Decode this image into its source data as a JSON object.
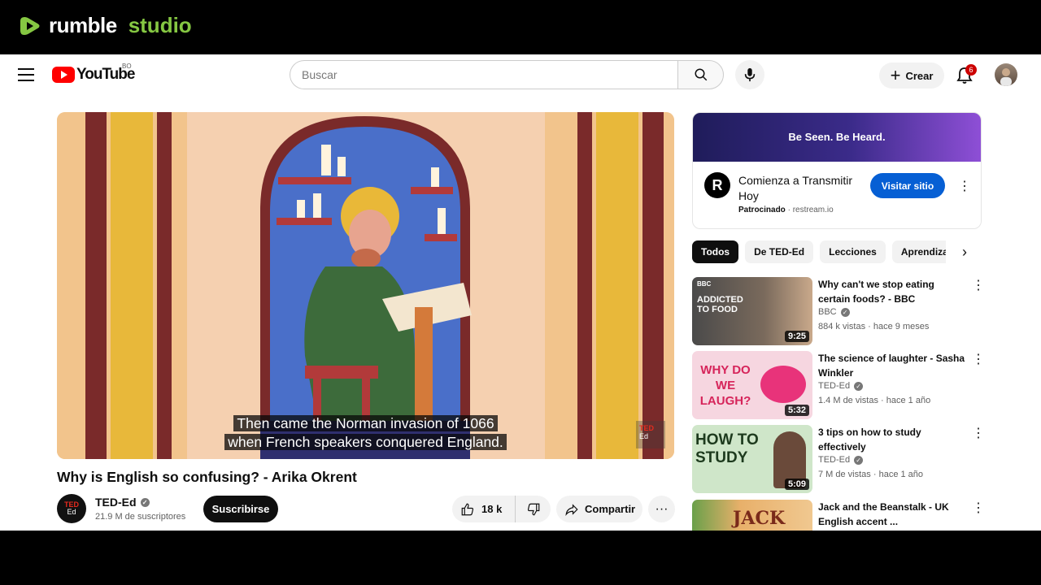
{
  "rumble": {
    "brand": "rumble",
    "product": "studio"
  },
  "masthead": {
    "country_code": "BO",
    "search_placeholder": "Buscar",
    "create_label": "Crear",
    "notifications_count": "6"
  },
  "player": {
    "caption_line1": "Then came the Norman invasion of 1066",
    "caption_line2": "when French speakers conquered England.",
    "watermark": "Ed"
  },
  "video": {
    "title": "Why is English so confusing? - Arika Okrent",
    "channel": "TED-Ed",
    "subscribers": "21.9 M de suscriptores",
    "subscribe_label": "Suscribirse",
    "likes": "18 k",
    "share_label": "Compartir"
  },
  "ad": {
    "banner_text": "Be Seen. Be Heard.",
    "logo_letter": "R",
    "title": "Comienza a Transmitir Hoy",
    "sponsored": "Patrocinado",
    "domain": "restream.io",
    "cta": "Visitar sitio"
  },
  "chips": [
    "Todos",
    "De TED-Ed",
    "Lecciones",
    "Aprendizaje"
  ],
  "recommendations": [
    {
      "title": "Why can't we stop eating certain foods? - BBC",
      "channel": "BBC",
      "meta": "884 k vistas · hace 9 meses",
      "duration": "9:25",
      "thumb_text": "ADDICTED TO FOOD",
      "thumb_corner": "BBC"
    },
    {
      "title": "The science of laughter - Sasha Winkler",
      "channel": "TED-Ed",
      "meta": "1.4 M de vistas · hace 1 año",
      "duration": "5:32",
      "thumb_text": "WHY DO WE LAUGH?"
    },
    {
      "title": "3 tips on how to study effectively",
      "channel": "TED-Ed",
      "meta": "7 M de vistas · hace 1 año",
      "duration": "5:09",
      "thumb_text": "HOW TO STUDY"
    },
    {
      "title": "Jack and the Beanstalk - UK English accent ...",
      "thumb_text": "JACK"
    }
  ],
  "colors": {
    "youtube_red": "#ff0000",
    "rumble_green": "#85c742",
    "cta_blue": "#065fd4"
  }
}
